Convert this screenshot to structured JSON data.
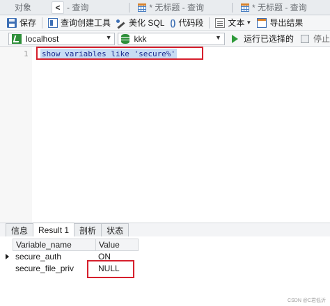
{
  "tabs": [
    {
      "label": "对象"
    },
    {
      "label": "- 查询"
    },
    {
      "label": "* 无标题 - 查询"
    },
    {
      "label": "* 无标题 - 查询"
    }
  ],
  "toolbar": {
    "save": "保存",
    "query_builder": "查询创建工具",
    "beautify_sql": "美化 SQL",
    "code_snippet_icon": "()",
    "code_snippet": "代码段",
    "text": "文本",
    "export_result": "导出结果"
  },
  "connection": {
    "host": "localhost",
    "database": "kkk",
    "run_selected": "运行已选择的",
    "stop": "停止"
  },
  "editor": {
    "line_number": "1",
    "sql": "show variables like 'secure%'"
  },
  "result_tabs": [
    {
      "label": "信息"
    },
    {
      "label": "Result 1"
    },
    {
      "label": "剖析"
    },
    {
      "label": "状态"
    }
  ],
  "result": {
    "columns": [
      "Variable_name",
      "Value"
    ],
    "rows": [
      {
        "name": "secure_auth",
        "value": "ON"
      },
      {
        "name": "secure_file_priv",
        "value": "NULL"
      }
    ]
  },
  "watermark": "CSDN @C君低沂",
  "colors": {
    "highlight_box": "#d61f2c",
    "selection": "#c7dcf4",
    "run_green": "#2f9a3a",
    "accent_blue": "#3d6fb5"
  }
}
